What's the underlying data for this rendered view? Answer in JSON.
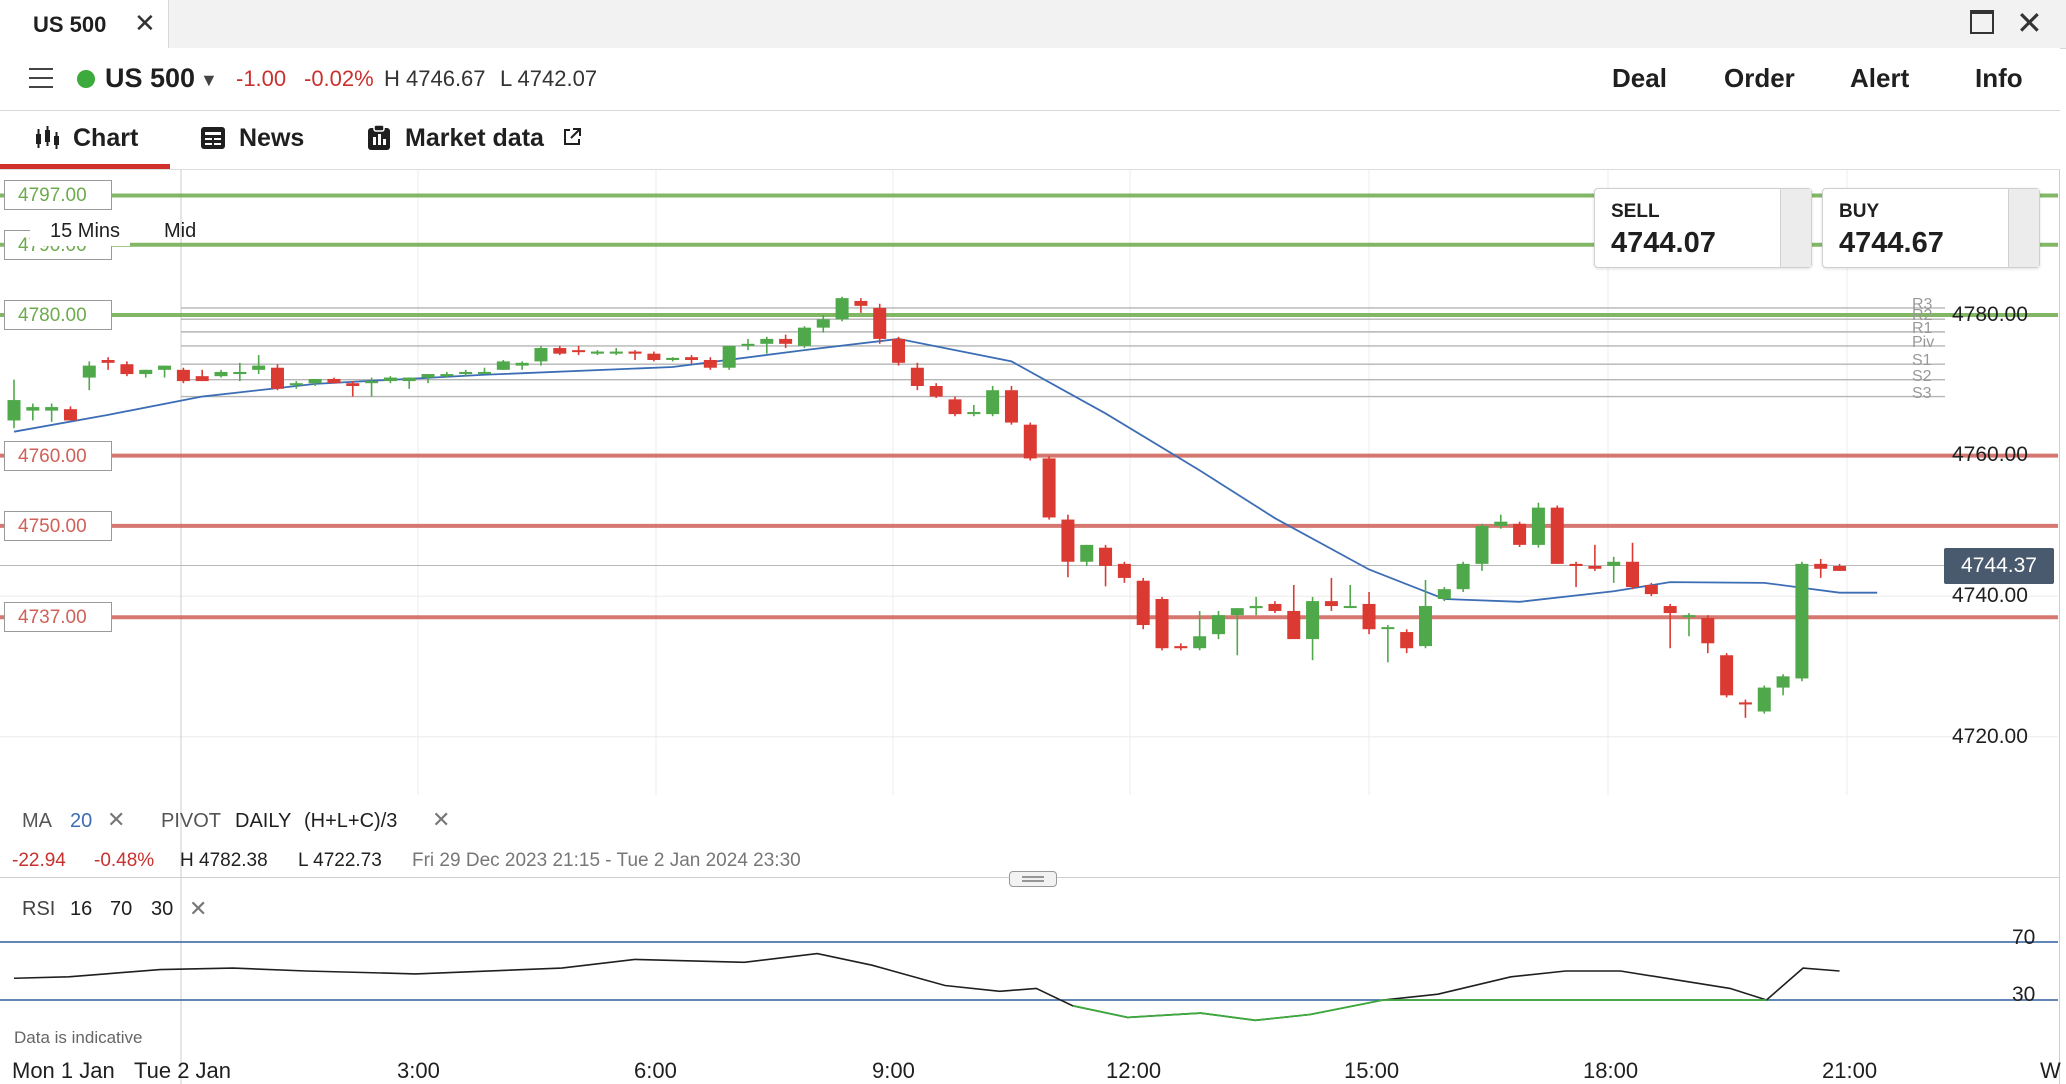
{
  "window": {
    "tab_title": "US 500"
  },
  "header": {
    "instrument": "US 500",
    "change_abs": "-1.00",
    "change_pct": "-0.02%",
    "high": "H 4746.67",
    "low": "L 4742.07",
    "buttons": [
      "Deal",
      "Order",
      "Alert",
      "Info"
    ]
  },
  "subtabs": {
    "chart": "Chart",
    "news": "News",
    "market_data": "Market data"
  },
  "chart": {
    "timeframe": "15 Mins",
    "price_mode": "Mid",
    "level_lines": [
      {
        "label": "4797.00",
        "price": 4797.0,
        "color": "#6dab4c"
      },
      {
        "label": "4790.00",
        "price": 4790.0,
        "color": "#6dab4c"
      },
      {
        "label": "4780.00",
        "price": 4780.0,
        "color": "#6dab4c"
      },
      {
        "label": "4760.00",
        "price": 4760.0,
        "color": "#d06058"
      },
      {
        "label": "4750.00",
        "price": 4750.0,
        "color": "#d06058"
      },
      {
        "label": "4737.00",
        "price": 4737.0,
        "color": "#d06058"
      }
    ],
    "pivot_labels": [
      "R3",
      "R2",
      "R1",
      "Piv",
      "S1",
      "S2",
      "S3"
    ],
    "price_axis": [
      "4780.00",
      "4760.00",
      "4740.00",
      "4720.00"
    ],
    "last_price": "4744.37",
    "x_axis": [
      "Mon 1 Jan",
      "Tue 2 Jan",
      "3:00",
      "6:00",
      "9:00",
      "12:00",
      "15:00",
      "18:00",
      "21:00",
      "W"
    ]
  },
  "deal": {
    "sell_label": "SELL",
    "sell_price": "4744.07",
    "buy_label": "BUY",
    "buy_price": "4744.67"
  },
  "indicators": {
    "ma_label": "MA",
    "ma_period": "20",
    "pivot_label": "PIVOT",
    "pivot_period": "DAILY",
    "pivot_formula": "(H+L+C)/3",
    "summary": {
      "change_abs": "-22.94",
      "change_pct": "-0.48%",
      "high": "H 4782.38",
      "low": "L 4722.73",
      "range": "Fri 29 Dec 2023 21:15 - Tue 2 Jan 2024 23:30"
    },
    "rsi_label": "RSI",
    "rsi_period": "16",
    "rsi_upper": "70",
    "rsi_lower": "30"
  },
  "rsi_axis": [
    "70",
    "30"
  ],
  "disclaimer": "Data is indicative",
  "chart_data": {
    "type": "candlestick",
    "timeframe": "15 Mins",
    "ylim": [
      4708,
      4800
    ],
    "moving_average_period": 20,
    "candles": [
      {
        "o": 4765.0,
        "h": 4770.8,
        "l": 4763.9,
        "c": 4767.9
      },
      {
        "o": 4766.4,
        "h": 4767.4,
        "l": 4765.0,
        "c": 4766.9
      },
      {
        "o": 4766.4,
        "h": 4767.4,
        "l": 4764.8,
        "c": 4766.9
      },
      {
        "o": 4766.6,
        "h": 4767.0,
        "l": 4765.0,
        "c": 4765.0
      },
      {
        "o": 4771.1,
        "h": 4773.4,
        "l": 4769.3,
        "c": 4772.8
      },
      {
        "o": 4773.6,
        "h": 4774.0,
        "l": 4772.2,
        "c": 4773.2
      },
      {
        "o": 4773.0,
        "h": 4773.4,
        "l": 4771.3,
        "c": 4771.6
      },
      {
        "o": 4771.6,
        "h": 4772.2,
        "l": 4771.1,
        "c": 4772.2
      },
      {
        "o": 4772.2,
        "h": 4772.8,
        "l": 4771.1,
        "c": 4772.8
      },
      {
        "o": 4772.2,
        "h": 4772.5,
        "l": 4770.3,
        "c": 4770.6
      },
      {
        "o": 4771.3,
        "h": 4772.2,
        "l": 4770.6,
        "c": 4770.6
      },
      {
        "o": 4771.3,
        "h": 4772.2,
        "l": 4771.1,
        "c": 4771.9
      },
      {
        "o": 4771.6,
        "h": 4773.2,
        "l": 4770.6,
        "c": 4771.9
      },
      {
        "o": 4772.2,
        "h": 4774.3,
        "l": 4771.6,
        "c": 4772.8
      },
      {
        "o": 4772.5,
        "h": 4773.0,
        "l": 4769.3,
        "c": 4769.5
      },
      {
        "o": 4770.3,
        "h": 4770.6,
        "l": 4769.5,
        "c": 4770.3
      },
      {
        "o": 4770.3,
        "h": 4770.9,
        "l": 4769.9,
        "c": 4770.9
      },
      {
        "o": 4770.9,
        "h": 4771.1,
        "l": 4770.3,
        "c": 4770.3
      },
      {
        "o": 4770.3,
        "h": 4770.6,
        "l": 4768.4,
        "c": 4769.9
      },
      {
        "o": 4770.3,
        "h": 4771.1,
        "l": 4768.4,
        "c": 4770.6
      },
      {
        "o": 4770.6,
        "h": 4771.3,
        "l": 4770.3,
        "c": 4771.1
      },
      {
        "o": 4770.6,
        "h": 4771.1,
        "l": 4769.5,
        "c": 4771.1
      },
      {
        "o": 4771.1,
        "h": 4771.6,
        "l": 4770.3,
        "c": 4771.6
      },
      {
        "o": 4771.3,
        "h": 4771.9,
        "l": 4771.1,
        "c": 4771.6
      },
      {
        "o": 4771.6,
        "h": 4772.2,
        "l": 4771.3,
        "c": 4771.9
      },
      {
        "o": 4771.9,
        "h": 4772.5,
        "l": 4771.6,
        "c": 4771.9
      },
      {
        "o": 4772.2,
        "h": 4773.6,
        "l": 4772.2,
        "c": 4773.4
      },
      {
        "o": 4772.8,
        "h": 4773.4,
        "l": 4772.2,
        "c": 4773.2
      },
      {
        "o": 4773.4,
        "h": 4775.6,
        "l": 4772.8,
        "c": 4775.3
      },
      {
        "o": 4775.3,
        "h": 4775.6,
        "l": 4774.3,
        "c": 4774.5
      },
      {
        "o": 4775.0,
        "h": 4775.6,
        "l": 4774.3,
        "c": 4774.8
      },
      {
        "o": 4774.5,
        "h": 4775.0,
        "l": 4774.3,
        "c": 4774.8
      },
      {
        "o": 4774.5,
        "h": 4775.3,
        "l": 4774.3,
        "c": 4774.8
      },
      {
        "o": 4774.8,
        "h": 4775.0,
        "l": 4773.6,
        "c": 4774.5
      },
      {
        "o": 4774.5,
        "h": 4774.8,
        "l": 4773.4,
        "c": 4773.6
      },
      {
        "o": 4773.6,
        "h": 4774.0,
        "l": 4773.4,
        "c": 4773.9
      },
      {
        "o": 4774.0,
        "h": 4774.3,
        "l": 4773.0,
        "c": 4773.6
      },
      {
        "o": 4773.6,
        "h": 4774.0,
        "l": 4772.2,
        "c": 4772.5
      },
      {
        "o": 4772.5,
        "h": 4775.6,
        "l": 4772.2,
        "c": 4775.6
      },
      {
        "o": 4775.6,
        "h": 4776.6,
        "l": 4775.0,
        "c": 4775.9
      },
      {
        "o": 4775.9,
        "h": 4776.9,
        "l": 4774.5,
        "c": 4776.6
      },
      {
        "o": 4776.6,
        "h": 4777.2,
        "l": 4775.3,
        "c": 4775.9
      },
      {
        "o": 4775.6,
        "h": 4778.4,
        "l": 4775.3,
        "c": 4778.2
      },
      {
        "o": 4778.2,
        "h": 4780.0,
        "l": 4777.5,
        "c": 4779.4
      },
      {
        "o": 4779.4,
        "h": 4782.6,
        "l": 4779.1,
        "c": 4782.4
      },
      {
        "o": 4782.0,
        "h": 4782.4,
        "l": 4780.3,
        "c": 4781.3
      },
      {
        "o": 4781.0,
        "h": 4781.6,
        "l": 4775.9,
        "c": 4776.6
      },
      {
        "o": 4776.6,
        "h": 4776.9,
        "l": 4772.8,
        "c": 4773.2
      },
      {
        "o": 4772.5,
        "h": 4773.2,
        "l": 4769.3,
        "c": 4769.9
      },
      {
        "o": 4769.9,
        "h": 4770.3,
        "l": 4768.2,
        "c": 4768.4
      },
      {
        "o": 4768.0,
        "h": 4768.4,
        "l": 4765.6,
        "c": 4765.9
      },
      {
        "o": 4765.9,
        "h": 4767.2,
        "l": 4765.6,
        "c": 4766.2
      },
      {
        "o": 4765.9,
        "h": 4769.9,
        "l": 4765.6,
        "c": 4769.3
      },
      {
        "o": 4769.3,
        "h": 4769.9,
        "l": 4764.4,
        "c": 4764.7
      },
      {
        "o": 4764.4,
        "h": 4764.7,
        "l": 4759.3,
        "c": 4759.6
      },
      {
        "o": 4759.6,
        "h": 4759.9,
        "l": 4750.9,
        "c": 4751.2
      },
      {
        "o": 4750.9,
        "h": 4751.6,
        "l": 4742.7,
        "c": 4744.9
      },
      {
        "o": 4744.9,
        "h": 4747.3,
        "l": 4744.3,
        "c": 4747.3
      },
      {
        "o": 4746.9,
        "h": 4747.3,
        "l": 4741.4,
        "c": 4744.3
      },
      {
        "o": 4744.6,
        "h": 4744.9,
        "l": 4741.9,
        "c": 4742.6
      },
      {
        "o": 4742.2,
        "h": 4742.6,
        "l": 4735.3,
        "c": 4735.9
      },
      {
        "o": 4739.6,
        "h": 4739.9,
        "l": 4732.3,
        "c": 4732.6
      },
      {
        "o": 4732.9,
        "h": 4733.3,
        "l": 4732.3,
        "c": 4732.6
      },
      {
        "o": 4732.6,
        "h": 4737.9,
        "l": 4732.3,
        "c": 4734.3
      },
      {
        "o": 4734.6,
        "h": 4737.9,
        "l": 4733.9,
        "c": 4737.3
      },
      {
        "o": 4737.3,
        "h": 4738.3,
        "l": 4731.6,
        "c": 4738.3
      },
      {
        "o": 4738.3,
        "h": 4739.9,
        "l": 4737.3,
        "c": 4738.6
      },
      {
        "o": 4738.9,
        "h": 4739.3,
        "l": 4737.6,
        "c": 4737.9
      },
      {
        "o": 4737.9,
        "h": 4741.6,
        "l": 4733.9,
        "c": 4733.9
      },
      {
        "o": 4733.9,
        "h": 4739.9,
        "l": 4730.9,
        "c": 4739.3
      },
      {
        "o": 4739.3,
        "h": 4742.6,
        "l": 4737.9,
        "c": 4738.6
      },
      {
        "o": 4738.6,
        "h": 4741.6,
        "l": 4738.3,
        "c": 4738.6
      },
      {
        "o": 4738.9,
        "h": 4740.6,
        "l": 4734.6,
        "c": 4735.3
      },
      {
        "o": 4735.6,
        "h": 4735.9,
        "l": 4730.6,
        "c": 4735.6
      },
      {
        "o": 4734.9,
        "h": 4735.3,
        "l": 4731.9,
        "c": 4732.6
      },
      {
        "o": 4732.9,
        "h": 4742.3,
        "l": 4732.6,
        "c": 4738.6
      },
      {
        "o": 4739.6,
        "h": 4741.3,
        "l": 4739.3,
        "c": 4741.0
      },
      {
        "o": 4741.0,
        "h": 4744.9,
        "l": 4740.6,
        "c": 4744.6
      },
      {
        "o": 4744.6,
        "h": 4750.3,
        "l": 4743.6,
        "c": 4750.0
      },
      {
        "o": 4750.0,
        "h": 4751.6,
        "l": 4749.6,
        "c": 4750.6
      },
      {
        "o": 4750.3,
        "h": 4750.6,
        "l": 4747.0,
        "c": 4747.3
      },
      {
        "o": 4747.3,
        "h": 4753.3,
        "l": 4746.9,
        "c": 4752.6
      },
      {
        "o": 4752.6,
        "h": 4752.9,
        "l": 4744.6,
        "c": 4744.6
      },
      {
        "o": 4744.6,
        "h": 4744.9,
        "l": 4741.3,
        "c": 4744.3
      },
      {
        "o": 4744.3,
        "h": 4747.3,
        "l": 4743.6,
        "c": 4743.9
      },
      {
        "o": 4744.3,
        "h": 4745.6,
        "l": 4741.9,
        "c": 4744.9
      },
      {
        "o": 4744.9,
        "h": 4747.6,
        "l": 4741.0,
        "c": 4741.3
      },
      {
        "o": 4741.6,
        "h": 4741.9,
        "l": 4740.0,
        "c": 4740.3
      },
      {
        "o": 4738.6,
        "h": 4738.9,
        "l": 4732.6,
        "c": 4737.6
      },
      {
        "o": 4737.3,
        "h": 4737.6,
        "l": 4734.3,
        "c": 4737.3
      },
      {
        "o": 4736.9,
        "h": 4737.3,
        "l": 4731.9,
        "c": 4733.3
      },
      {
        "o": 4731.6,
        "h": 4731.9,
        "l": 4725.6,
        "c": 4725.9
      },
      {
        "o": 4724.9,
        "h": 4725.3,
        "l": 4722.7,
        "c": 4724.6
      },
      {
        "o": 4723.6,
        "h": 4727.3,
        "l": 4723.3,
        "c": 4727.0
      },
      {
        "o": 4727.0,
        "h": 4728.9,
        "l": 4725.9,
        "c": 4728.6
      },
      {
        "o": 4728.3,
        "h": 4744.9,
        "l": 4727.9,
        "c": 4744.6
      },
      {
        "o": 4744.6,
        "h": 4745.3,
        "l": 4742.6,
        "c": 4743.9
      },
      {
        "o": 4744.3,
        "h": 4744.6,
        "l": 4743.6,
        "c": 4743.6
      }
    ],
    "moving_average": [
      {
        "x": 0,
        "y": 4763.4
      },
      {
        "x": 5,
        "y": 4765.8
      },
      {
        "x": 10,
        "y": 4768.4
      },
      {
        "x": 16,
        "y": 4770.2
      },
      {
        "x": 25,
        "y": 4771.5
      },
      {
        "x": 35,
        "y": 4772.6
      },
      {
        "x": 42,
        "y": 4775.0
      },
      {
        "x": 47,
        "y": 4776.6
      },
      {
        "x": 53,
        "y": 4773.4
      },
      {
        "x": 58,
        "y": 4766.0
      },
      {
        "x": 63,
        "y": 4757.9
      },
      {
        "x": 67,
        "y": 4751.1
      },
      {
        "x": 72,
        "y": 4743.8
      },
      {
        "x": 76,
        "y": 4739.6
      },
      {
        "x": 80,
        "y": 4739.2
      },
      {
        "x": 85,
        "y": 4740.7
      },
      {
        "x": 88,
        "y": 4742.0
      },
      {
        "x": 93,
        "y": 4741.9
      },
      {
        "x": 97,
        "y": 4740.5
      },
      {
        "x": 99,
        "y": 4740.5
      }
    ],
    "rsi": [
      {
        "x": 0,
        "y": 45
      },
      {
        "x": 3,
        "y": 46
      },
      {
        "x": 5,
        "y": 48
      },
      {
        "x": 8,
        "y": 51
      },
      {
        "x": 12,
        "y": 52
      },
      {
        "x": 16,
        "y": 50
      },
      {
        "x": 22,
        "y": 48
      },
      {
        "x": 30,
        "y": 52
      },
      {
        "x": 34,
        "y": 58
      },
      {
        "x": 40,
        "y": 56
      },
      {
        "x": 44,
        "y": 62
      },
      {
        "x": 47,
        "y": 54
      },
      {
        "x": 51,
        "y": 40
      },
      {
        "x": 54,
        "y": 36
      },
      {
        "x": 56,
        "y": 38
      },
      {
        "x": 58,
        "y": 26
      },
      {
        "x": 61,
        "y": 18
      },
      {
        "x": 65,
        "y": 21
      },
      {
        "x": 68,
        "y": 16
      },
      {
        "x": 71,
        "y": 20
      },
      {
        "x": 75,
        "y": 30
      },
      {
        "x": 78,
        "y": 34
      },
      {
        "x": 82,
        "y": 46
      },
      {
        "x": 85,
        "y": 50
      },
      {
        "x": 88,
        "y": 50
      },
      {
        "x": 91,
        "y": 44
      },
      {
        "x": 94,
        "y": 38
      },
      {
        "x": 96,
        "y": 30
      },
      {
        "x": 98,
        "y": 52
      },
      {
        "x": 100,
        "y": 50
      }
    ],
    "rsi_levels": [
      70,
      30
    ]
  }
}
